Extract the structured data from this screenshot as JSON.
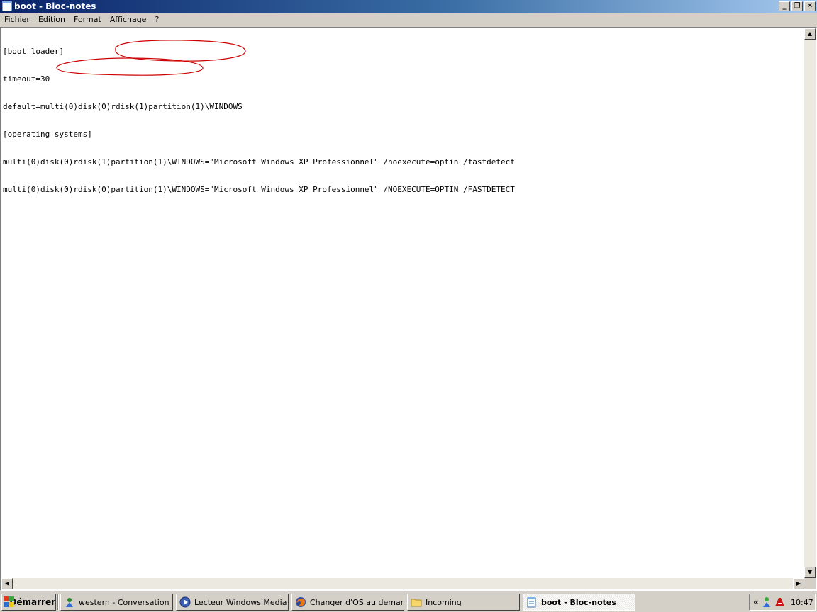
{
  "window": {
    "title": "boot - Bloc-notes",
    "minimize_glyph": "_",
    "maximize_glyph": "❐",
    "close_glyph": "✕"
  },
  "menu": {
    "items": [
      "Fichier",
      "Edition",
      "Format",
      "Affichage",
      "?"
    ]
  },
  "document": {
    "lines": [
      "[boot loader]",
      "timeout=30",
      "default=multi(0)disk(0)rdisk(1)partition(1)\\WINDOWS",
      "[operating systems]",
      "multi(0)disk(0)rdisk(1)partition(1)\\WINDOWS=\"Microsoft Windows XP Professionnel\" /noexecute=optin /fastdetect",
      "multi(0)disk(0)rdisk(0)partition(1)\\WINDOWS=\"Microsoft Windows XP Professionnel\" /NOEXECUTE=OPTIN /FASTDETECT"
    ],
    "annotation_color": "#cc0000"
  },
  "scrollbars": {
    "up_glyph": "▲",
    "down_glyph": "▼",
    "left_glyph": "◀",
    "right_glyph": "▶"
  },
  "taskbar": {
    "start_label": "Démarrer",
    "tasks": [
      {
        "label": "western - Conversation",
        "icon": "messenger-icon"
      },
      {
        "label": "Lecteur Windows Media",
        "icon": "media-player-icon"
      },
      {
        "label": "Changer d'OS au demarr...",
        "icon": "firefox-icon"
      },
      {
        "label": "Incoming",
        "icon": "folder-icon"
      },
      {
        "label": "boot - Bloc-notes",
        "icon": "notepad-icon",
        "active": true
      }
    ],
    "tray": {
      "chevron": "«",
      "clock": "10:47"
    }
  }
}
